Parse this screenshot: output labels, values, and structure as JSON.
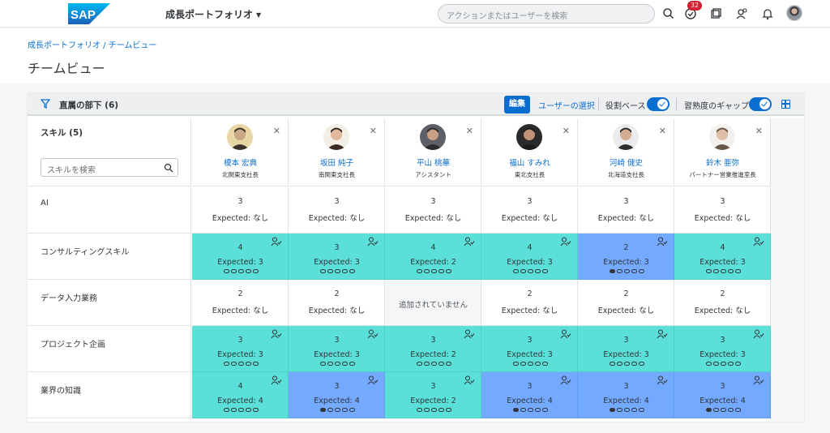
{
  "shell": {
    "logo_text": "SAP",
    "app_title": "成長ポートフォリオ",
    "search_placeholder": "アクションまたはユーザーを検索",
    "notification_count": "32"
  },
  "header": {
    "breadcrumb": "成長ポートフォリオ / チームビュー",
    "title": "チームビュー"
  },
  "toolbar": {
    "title": "直属の部下 (6)",
    "edit_label": "編集",
    "select_users_label": "ユーザーの選択",
    "role_based_label": "役割ベース",
    "role_based_on": true,
    "proficiency_gap_label": "習熟度のギャップ",
    "proficiency_gap_on": true
  },
  "skills_panel": {
    "title": "スキル (5)",
    "search_placeholder": "スキルを検索"
  },
  "users": [
    {
      "name": "榎本 宏典",
      "role": "北関東支社長",
      "photo": "man-1"
    },
    {
      "name": "坂田 純子",
      "role": "南関東支社長",
      "photo": "woman-1"
    },
    {
      "name": "平山 桃華",
      "role": "アシスタント",
      "photo": "man-2"
    },
    {
      "name": "福山 すみれ",
      "role": "東北支社長",
      "photo": "woman-2"
    },
    {
      "name": "河崎 健史",
      "role": "北海道支社長",
      "photo": "man-3"
    },
    {
      "name": "鈴木 亜弥",
      "role": "パートナー営業推進室長",
      "photo": "woman-3"
    }
  ],
  "rows": [
    {
      "skill": "AI",
      "cells": [
        {
          "level": "3",
          "expected": "Expected: なし",
          "state": "plain"
        },
        {
          "level": "3",
          "expected": "Expected: なし",
          "state": "plain"
        },
        {
          "level": "3",
          "expected": "Expected: なし",
          "state": "plain"
        },
        {
          "level": "3",
          "expected": "Expected: なし",
          "state": "plain"
        },
        {
          "level": "3",
          "expected": "Expected: なし",
          "state": "plain"
        },
        {
          "level": "3",
          "expected": "Expected: なし",
          "state": "plain"
        }
      ]
    },
    {
      "skill": "コンサルティングスキル",
      "cells": [
        {
          "level": "4",
          "expected": "Expected: 3",
          "state": "green",
          "gap": 0
        },
        {
          "level": "3",
          "expected": "Expected: 3",
          "state": "green",
          "gap": 0
        },
        {
          "level": "4",
          "expected": "Expected: 2",
          "state": "green",
          "gap": 0
        },
        {
          "level": "4",
          "expected": "Expected: 3",
          "state": "green",
          "gap": 0
        },
        {
          "level": "2",
          "expected": "Expected: 3",
          "state": "blue",
          "gap": 1
        },
        {
          "level": "4",
          "expected": "Expected: 3",
          "state": "green",
          "gap": 0
        }
      ]
    },
    {
      "skill": "データ入力業務",
      "cells": [
        {
          "level": "2",
          "expected": "Expected: なし",
          "state": "plain"
        },
        {
          "level": "2",
          "expected": "Expected: なし",
          "state": "plain"
        },
        {
          "level": "",
          "expected": "",
          "state": "na",
          "note": "追加されていません"
        },
        {
          "level": "2",
          "expected": "Expected: なし",
          "state": "plain"
        },
        {
          "level": "2",
          "expected": "Expected: なし",
          "state": "plain"
        },
        {
          "level": "2",
          "expected": "Expected: なし",
          "state": "plain"
        }
      ]
    },
    {
      "skill": "プロジェクト企画",
      "cells": [
        {
          "level": "3",
          "expected": "Expected: 3",
          "state": "green",
          "gap": 0
        },
        {
          "level": "3",
          "expected": "Expected: 3",
          "state": "green",
          "gap": 0
        },
        {
          "level": "3",
          "expected": "Expected: 2",
          "state": "green",
          "gap": 0
        },
        {
          "level": "3",
          "expected": "Expected: 3",
          "state": "green",
          "gap": 0
        },
        {
          "level": "3",
          "expected": "Expected: 3",
          "state": "green",
          "gap": 0
        },
        {
          "level": "3",
          "expected": "Expected: 3",
          "state": "green",
          "gap": 0
        }
      ]
    },
    {
      "skill": "業界の知識",
      "cells": [
        {
          "level": "4",
          "expected": "Expected: 4",
          "state": "green",
          "gap": 0
        },
        {
          "level": "3",
          "expected": "Expected: 4",
          "state": "blue",
          "gap": 1
        },
        {
          "level": "3",
          "expected": "Expected: 2",
          "state": "green",
          "gap": 0
        },
        {
          "level": "3",
          "expected": "Expected: 4",
          "state": "blue",
          "gap": 1
        },
        {
          "level": "3",
          "expected": "Expected: 4",
          "state": "blue",
          "gap": 1
        },
        {
          "level": "3",
          "expected": "Expected: 4",
          "state": "blue",
          "gap": 1
        }
      ]
    }
  ],
  "colors": {
    "accent": "#0a6ed1",
    "meets": "#5ae0d8",
    "gap": "#73a9ff"
  }
}
